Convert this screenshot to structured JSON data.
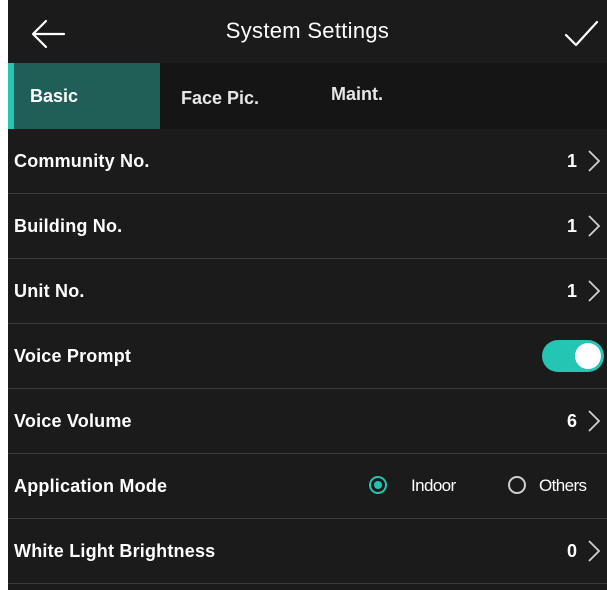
{
  "header": {
    "title": "System Settings",
    "back_icon": "back-arrow-icon",
    "confirm_icon": "checkmark-icon"
  },
  "tabs": [
    {
      "label": "Basic",
      "active": true
    },
    {
      "label": "Face Pic.",
      "active": false
    },
    {
      "label": "Maint.",
      "active": false
    }
  ],
  "rows": {
    "community": {
      "label": "Community No.",
      "value": "1"
    },
    "building": {
      "label": "Building No.",
      "value": "1"
    },
    "unit": {
      "label": "Unit No.",
      "value": "1"
    },
    "voice_prompt": {
      "label": "Voice Prompt",
      "enabled": true
    },
    "voice_volume": {
      "label": "Voice Volume",
      "value": "6"
    },
    "app_mode": {
      "label": "Application Mode",
      "options": [
        "Indoor",
        "Others"
      ],
      "selected": "Indoor"
    },
    "white_light": {
      "label": "White Light Brightness",
      "value": "0"
    }
  },
  "colors": {
    "background": "#1b1b1b",
    "accent": "#25c5b4",
    "active_tab": "#1f5f58",
    "divider": "#3c3c3c"
  }
}
